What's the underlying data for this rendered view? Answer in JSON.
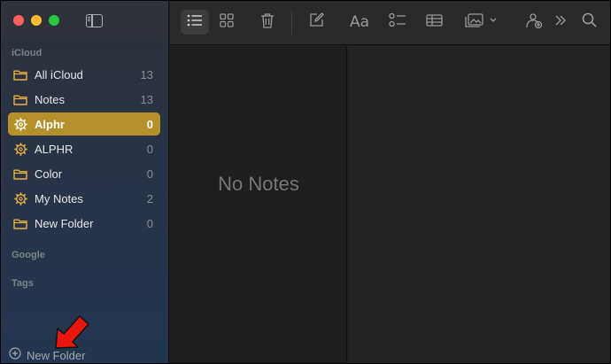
{
  "sidebar": {
    "sections": {
      "icloud": "iCloud",
      "google": "Google",
      "tags": "Tags"
    },
    "items": [
      {
        "label": "All iCloud",
        "count": "13",
        "icon": "folder-icon"
      },
      {
        "label": "Notes",
        "count": "13",
        "icon": "folder-icon"
      },
      {
        "label": "Alphr",
        "count": "0",
        "icon": "gear-icon",
        "selected": true
      },
      {
        "label": "ALPHR",
        "count": "0",
        "icon": "gear-icon"
      },
      {
        "label": "Color",
        "count": "0",
        "icon": "folder-icon"
      },
      {
        "label": "My Notes",
        "count": "2",
        "icon": "gear-icon"
      },
      {
        "label": "New Folder",
        "count": "0",
        "icon": "folder-icon"
      }
    ],
    "new_folder_label": "New Folder"
  },
  "toolbar": {
    "format_label": "Aa",
    "icons": [
      "list-view-icon",
      "gallery-view-icon",
      "trash-icon",
      "compose-icon",
      "format-icon",
      "checklist-icon",
      "table-icon",
      "media-icon",
      "collaborate-icon",
      "more-icon",
      "search-icon"
    ]
  },
  "note_list": {
    "empty_text": "No Notes"
  },
  "colors": {
    "accent": "#b6912b",
    "folder_icon": "#e7b13f",
    "annotation_arrow": "#e8170f"
  }
}
